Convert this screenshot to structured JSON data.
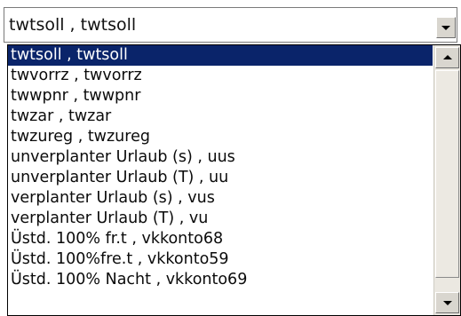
{
  "combobox": {
    "selected_value": "twtsoll , twtsoll"
  },
  "dropdown": {
    "items": [
      {
        "label": "twtsoll , twtsoll",
        "selected": true
      },
      {
        "label": "twvorrz , twvorrz",
        "selected": false
      },
      {
        "label": "twwpnr , twwpnr",
        "selected": false
      },
      {
        "label": "twzar , twzar",
        "selected": false
      },
      {
        "label": "twzureg , twzureg",
        "selected": false
      },
      {
        "label": "unverplanter Urlaub (s) , uus",
        "selected": false
      },
      {
        "label": "unverplanter Urlaub (T) , uu",
        "selected": false
      },
      {
        "label": "verplanter Urlaub (s) , vus",
        "selected": false
      },
      {
        "label": "verplanter Urlaub (T) , vu",
        "selected": false
      },
      {
        "label": "Üstd. 100% fr.t , vkkonto68",
        "selected": false
      },
      {
        "label": "Üstd. 100%fre.t , vkkonto59",
        "selected": false
      },
      {
        "label": "Üstd. 100% Nacht , vkkonto69",
        "selected": false
      }
    ]
  },
  "icons": {
    "combo_arrow": "chevron-down-icon",
    "scroll_up": "scroll-up-arrow-icon",
    "scroll_down": "scroll-down-arrow-icon"
  },
  "colors": {
    "selection_background": "#0a246a",
    "selection_text": "#ffffff",
    "list_text": "#0b0b0b",
    "button_face": "#d9d6cf"
  }
}
